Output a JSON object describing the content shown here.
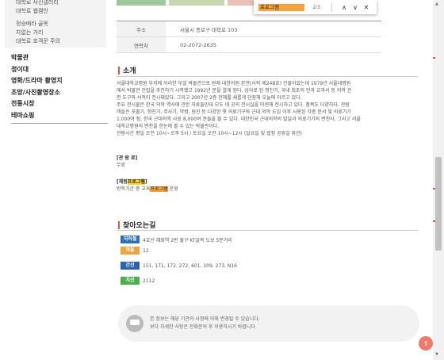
{
  "sidebar": {
    "sub_items": [
      "대학로 사진갤러리",
      "대학로 웹캠인",
      "정승배라 골목",
      "차없는 거리",
      "대학로 호객꾼 주의"
    ],
    "main_items": [
      "박물관",
      "정이대",
      "영화/드라마 촬영지",
      "조망/사진촬영장소",
      "전통시장",
      "테마쇼핑"
    ]
  },
  "info_table": {
    "rows": [
      {
        "key": "주소",
        "value": "서울시 종로구 대학로 103"
      },
      {
        "key": "연락처",
        "value": "02-2072-2635"
      }
    ]
  },
  "intro": {
    "heading": "소개",
    "paragraph": [
      "서울대학교병원 부지에 자리한 부설 박물관으로 원래 대한의원 본관(사적 제248호) 건물이었는데 1979년 서울대병원",
      "에서 박물관 건립을 추진하기 시작했고 1992년 문을 열게 된다. 상아로 된 청진기, 국내 최초의 안과 교과서 등 의학 관",
      "련 도구와 서적이 전시돼있다. 그리고 2007년 2층 전체를 새롭게 단장해 오늘에 이르고 있다.",
      "주요 전시물은 한국 의학 역사에 관한 자료들인데 모두 네 곳의 전시실을 마련해 전시하고 있다. 품목도 다양하다. 관람",
      "객들은 포졸기, 청진기, 주사기, 약병, 원진 등 다양한 옛 의료기구와 근대 의학 도입 이후 사용된 각종 문서 및 의료기기",
      "1,000여 점, 한국 근대의학 사료 8,000여 권들을 볼 수 있다. 대한민국 근대의학의 발달과 의료기기의 변천사, 그리고 서울",
      "대학교병원의 변천을 한눈에 볼 수 있는 박물관이다.",
      "관람시간 평일 오전 10시~오후 5시 / 토요일 오전 10시~12시 (일요일 및 법정 공휴일 휴관)"
    ],
    "fee_label": "[관 람 료]",
    "fee_value": "무료",
    "program_label_pre": "[체험",
    "program_label_hl": "프로그램",
    "program_label_post": "]",
    "program_pre": "방학기간 중 교육",
    "program_hl": "프로그램",
    "program_post": " 운영"
  },
  "directions": {
    "heading": "찾아오는길",
    "items": [
      {
        "badge": "지하철",
        "color": "#2f6fb7",
        "text": "4호선 혜화역 2번 출구 KT골목 도보 5분거리"
      },
      {
        "badge": "마을",
        "color": "#f0a33a",
        "text": "12"
      },
      {
        "badge": "간선",
        "color": "#2a63b0",
        "text": "151, 171, 172, 272, 601, 109, 273, N16"
      },
      {
        "badge": "지선",
        "color": "#4caf50",
        "text": "2112"
      }
    ]
  },
  "notice": {
    "line1": "본 정보는 해당 기관의 사정에 의해 변경될 수 있습니다.",
    "line2": "보다 자세한 사항은 전화문의 후 이용하시기 바랍니다."
  },
  "findbar": {
    "query": "프로그램",
    "count": "2/3",
    "prev": "∧",
    "next": "∨",
    "close": "✕"
  },
  "top_button_glyph": "↑",
  "colors": {
    "accent": "#e2553b",
    "highlight_current": "#f7a23a",
    "highlight_other": "#ffd81a"
  }
}
